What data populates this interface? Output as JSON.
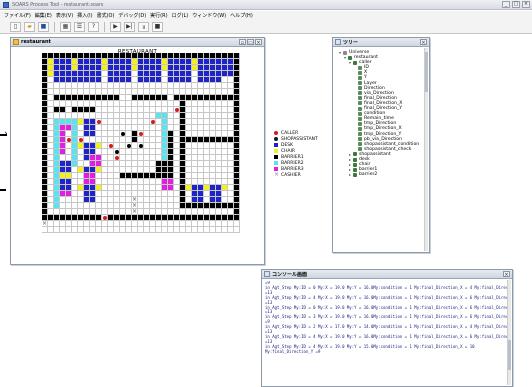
{
  "window": {
    "title": "SOARS Process Tool - restaurant.soars"
  },
  "menu": [
    "ファイル(F)",
    "編集(E)",
    "表示(V)",
    "挿入(I)",
    "書式(O)",
    "デバッグ(D)",
    "実行(R)",
    "ログ(L)",
    "ウィンドウ(W)",
    "ヘルプ(H)"
  ],
  "toolbar": {
    "icons": [
      "new-icon",
      "open-icon",
      "save-icon",
      "grid-icon",
      "table-icon",
      "help-icon",
      "play-icon",
      "step-icon",
      "pause-icon",
      "stop-icon"
    ]
  },
  "restaurant": {
    "frame_title": "restaurant",
    "grid_title": "RESTAURANT",
    "legend": [
      {
        "label": "CALLER",
        "color": "#d41c1c"
      },
      {
        "label": "SHOPASSISTANT",
        "color": "#1a1a1a"
      },
      {
        "label": "DESK",
        "color": "#1e24c8"
      },
      {
        "label": "CHAIR",
        "color": "#f4f11a"
      },
      {
        "label": "BARRIER1",
        "color": "#000000"
      },
      {
        "label": "BARRIER2",
        "color": "#59e3ee"
      },
      {
        "label": "BARRIER3",
        "color": "#e020e0"
      },
      {
        "label": "CASHIER",
        "color": "#808080"
      }
    ]
  },
  "tree_window": {
    "title": "ツリー",
    "items": [
      {
        "label": "Universe",
        "indent": 0
      },
      {
        "label": "restaurant",
        "indent": 1
      },
      {
        "label": "caller",
        "indent": 2
      },
      {
        "label": "ID",
        "indent": 3
      },
      {
        "label": "X",
        "indent": 3
      },
      {
        "label": "Y",
        "indent": 3
      },
      {
        "label": "Layer",
        "indent": 3
      },
      {
        "label": "Direction",
        "indent": 3
      },
      {
        "label": "via_Direction",
        "indent": 3
      },
      {
        "label": "final_Direction",
        "indent": 3
      },
      {
        "label": "final_Direction_X",
        "indent": 3
      },
      {
        "label": "final_Direction_Y",
        "indent": 3
      },
      {
        "label": "condition",
        "indent": 3
      },
      {
        "label": "Remain_time",
        "indent": 3
      },
      {
        "label": "tmp_Direction",
        "indent": 3
      },
      {
        "label": "tmp_Direction_X",
        "indent": 3
      },
      {
        "label": "tmp_Direction_Y",
        "indent": 3
      },
      {
        "label": "pb_via_Direction",
        "indent": 3
      },
      {
        "label": "shopassistant_condition",
        "indent": 3
      },
      {
        "label": "shopassistant_check",
        "indent": 3
      },
      {
        "label": "shopassistant",
        "indent": 2
      },
      {
        "label": "desk",
        "indent": 2
      },
      {
        "label": "chair",
        "indent": 2
      },
      {
        "label": "barrier1",
        "indent": 2
      },
      {
        "label": "barrier2",
        "indent": 2
      }
    ]
  },
  "console": {
    "title": "コンソール画面",
    "lines": [
      "=9",
      "in Agt_Step My:ID = 0  My:X = 19.0  My:Y = 16.0My:condition = 1  My:final_Direction_X = 4  My:final_Direction_Y",
      "=13",
      "in Agt_Step My:ID = 4  My:X = 19.0  My:Y = 16.0My:condition = 1  My:final_Direction_X = 6  My:final_Direction_Y",
      "=13",
      "in Agt_Step My:ID = 0  My:X = 19.0  My:Y = 16.0My:condition = 1  My:final_Direction_X = 6  My:final_Direction_Y",
      "=13",
      "in Agt_Step My:ID = 3  My:X = 19.0  My:Y = 16.0My:condition = 1  My:final_Direction_X = 6  My:final_Direction_Y",
      "=9",
      "in Agt_Step My:ID = 2  My:X = 17.0  My:Y = 14.0My:condition = 1  My:final_Direction_X = 4  My:final_Direction_Y",
      "=13",
      "in Agt_Step My:ID = 4  My:X = 19.0  My:Y = 16.0My:condition = 1  My:final_Direction_X = 6  My:final_Direction_Y",
      "=13",
      "in Agt_Step My:ID = 4  My:X = 19.0  My:Y = 15.0My:condition = 1  My:final_Direction_X = 10",
      "My:final_Direction_Y =9"
    ]
  }
}
